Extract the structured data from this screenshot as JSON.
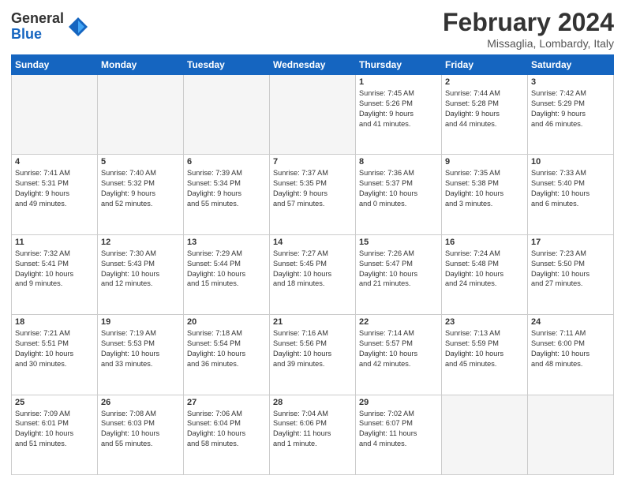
{
  "logo": {
    "general": "General",
    "blue": "Blue"
  },
  "header": {
    "title": "February 2024",
    "location": "Missaglia, Lombardy, Italy"
  },
  "columns": [
    "Sunday",
    "Monday",
    "Tuesday",
    "Wednesday",
    "Thursday",
    "Friday",
    "Saturday"
  ],
  "weeks": [
    [
      {
        "day": "",
        "info": ""
      },
      {
        "day": "",
        "info": ""
      },
      {
        "day": "",
        "info": ""
      },
      {
        "day": "",
        "info": ""
      },
      {
        "day": "1",
        "info": "Sunrise: 7:45 AM\nSunset: 5:26 PM\nDaylight: 9 hours\nand 41 minutes."
      },
      {
        "day": "2",
        "info": "Sunrise: 7:44 AM\nSunset: 5:28 PM\nDaylight: 9 hours\nand 44 minutes."
      },
      {
        "day": "3",
        "info": "Sunrise: 7:42 AM\nSunset: 5:29 PM\nDaylight: 9 hours\nand 46 minutes."
      }
    ],
    [
      {
        "day": "4",
        "info": "Sunrise: 7:41 AM\nSunset: 5:31 PM\nDaylight: 9 hours\nand 49 minutes."
      },
      {
        "day": "5",
        "info": "Sunrise: 7:40 AM\nSunset: 5:32 PM\nDaylight: 9 hours\nand 52 minutes."
      },
      {
        "day": "6",
        "info": "Sunrise: 7:39 AM\nSunset: 5:34 PM\nDaylight: 9 hours\nand 55 minutes."
      },
      {
        "day": "7",
        "info": "Sunrise: 7:37 AM\nSunset: 5:35 PM\nDaylight: 9 hours\nand 57 minutes."
      },
      {
        "day": "8",
        "info": "Sunrise: 7:36 AM\nSunset: 5:37 PM\nDaylight: 10 hours\nand 0 minutes."
      },
      {
        "day": "9",
        "info": "Sunrise: 7:35 AM\nSunset: 5:38 PM\nDaylight: 10 hours\nand 3 minutes."
      },
      {
        "day": "10",
        "info": "Sunrise: 7:33 AM\nSunset: 5:40 PM\nDaylight: 10 hours\nand 6 minutes."
      }
    ],
    [
      {
        "day": "11",
        "info": "Sunrise: 7:32 AM\nSunset: 5:41 PM\nDaylight: 10 hours\nand 9 minutes."
      },
      {
        "day": "12",
        "info": "Sunrise: 7:30 AM\nSunset: 5:43 PM\nDaylight: 10 hours\nand 12 minutes."
      },
      {
        "day": "13",
        "info": "Sunrise: 7:29 AM\nSunset: 5:44 PM\nDaylight: 10 hours\nand 15 minutes."
      },
      {
        "day": "14",
        "info": "Sunrise: 7:27 AM\nSunset: 5:45 PM\nDaylight: 10 hours\nand 18 minutes."
      },
      {
        "day": "15",
        "info": "Sunrise: 7:26 AM\nSunset: 5:47 PM\nDaylight: 10 hours\nand 21 minutes."
      },
      {
        "day": "16",
        "info": "Sunrise: 7:24 AM\nSunset: 5:48 PM\nDaylight: 10 hours\nand 24 minutes."
      },
      {
        "day": "17",
        "info": "Sunrise: 7:23 AM\nSunset: 5:50 PM\nDaylight: 10 hours\nand 27 minutes."
      }
    ],
    [
      {
        "day": "18",
        "info": "Sunrise: 7:21 AM\nSunset: 5:51 PM\nDaylight: 10 hours\nand 30 minutes."
      },
      {
        "day": "19",
        "info": "Sunrise: 7:19 AM\nSunset: 5:53 PM\nDaylight: 10 hours\nand 33 minutes."
      },
      {
        "day": "20",
        "info": "Sunrise: 7:18 AM\nSunset: 5:54 PM\nDaylight: 10 hours\nand 36 minutes."
      },
      {
        "day": "21",
        "info": "Sunrise: 7:16 AM\nSunset: 5:56 PM\nDaylight: 10 hours\nand 39 minutes."
      },
      {
        "day": "22",
        "info": "Sunrise: 7:14 AM\nSunset: 5:57 PM\nDaylight: 10 hours\nand 42 minutes."
      },
      {
        "day": "23",
        "info": "Sunrise: 7:13 AM\nSunset: 5:59 PM\nDaylight: 10 hours\nand 45 minutes."
      },
      {
        "day": "24",
        "info": "Sunrise: 7:11 AM\nSunset: 6:00 PM\nDaylight: 10 hours\nand 48 minutes."
      }
    ],
    [
      {
        "day": "25",
        "info": "Sunrise: 7:09 AM\nSunset: 6:01 PM\nDaylight: 10 hours\nand 51 minutes."
      },
      {
        "day": "26",
        "info": "Sunrise: 7:08 AM\nSunset: 6:03 PM\nDaylight: 10 hours\nand 55 minutes."
      },
      {
        "day": "27",
        "info": "Sunrise: 7:06 AM\nSunset: 6:04 PM\nDaylight: 10 hours\nand 58 minutes."
      },
      {
        "day": "28",
        "info": "Sunrise: 7:04 AM\nSunset: 6:06 PM\nDaylight: 11 hours\nand 1 minute."
      },
      {
        "day": "29",
        "info": "Sunrise: 7:02 AM\nSunset: 6:07 PM\nDaylight: 11 hours\nand 4 minutes."
      },
      {
        "day": "",
        "info": ""
      },
      {
        "day": "",
        "info": ""
      }
    ]
  ]
}
